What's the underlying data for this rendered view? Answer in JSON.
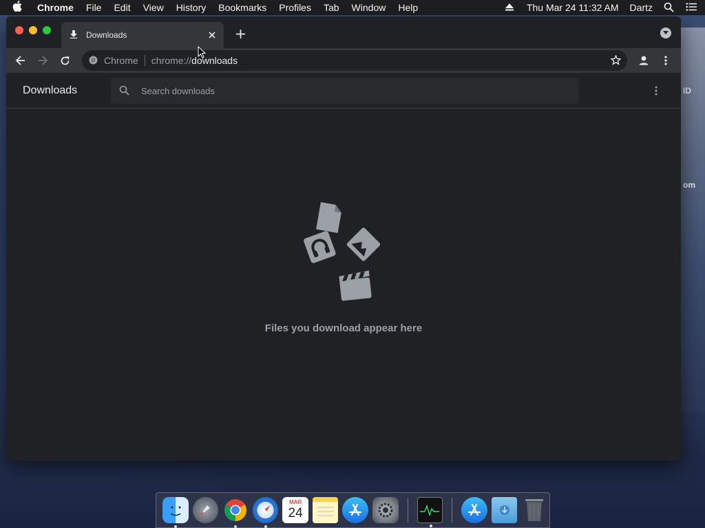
{
  "menubar": {
    "app_name": "Chrome",
    "items": [
      "File",
      "Edit",
      "View",
      "History",
      "Bookmarks",
      "Profiles",
      "Tab",
      "Window",
      "Help"
    ],
    "datetime": "Thu Mar 24  11:32 AM",
    "user": "Dartz"
  },
  "tab": {
    "title": "Downloads"
  },
  "omnibox": {
    "chip": "Chrome",
    "url_scheme": "chrome://",
    "url_host": "downloads"
  },
  "downloads": {
    "title": "Downloads",
    "search_placeholder": "Search downloads",
    "empty_message": "Files you download appear here"
  },
  "desktop": {
    "label1": "ID",
    "label2": "om"
  },
  "dock": {
    "calendar_month": "MAR",
    "calendar_day": "24"
  },
  "colors": {
    "window_bg": "#202124",
    "toolbar_bg": "#35363a",
    "text_primary": "#e8eaed",
    "text_secondary": "#9aa0a6"
  }
}
